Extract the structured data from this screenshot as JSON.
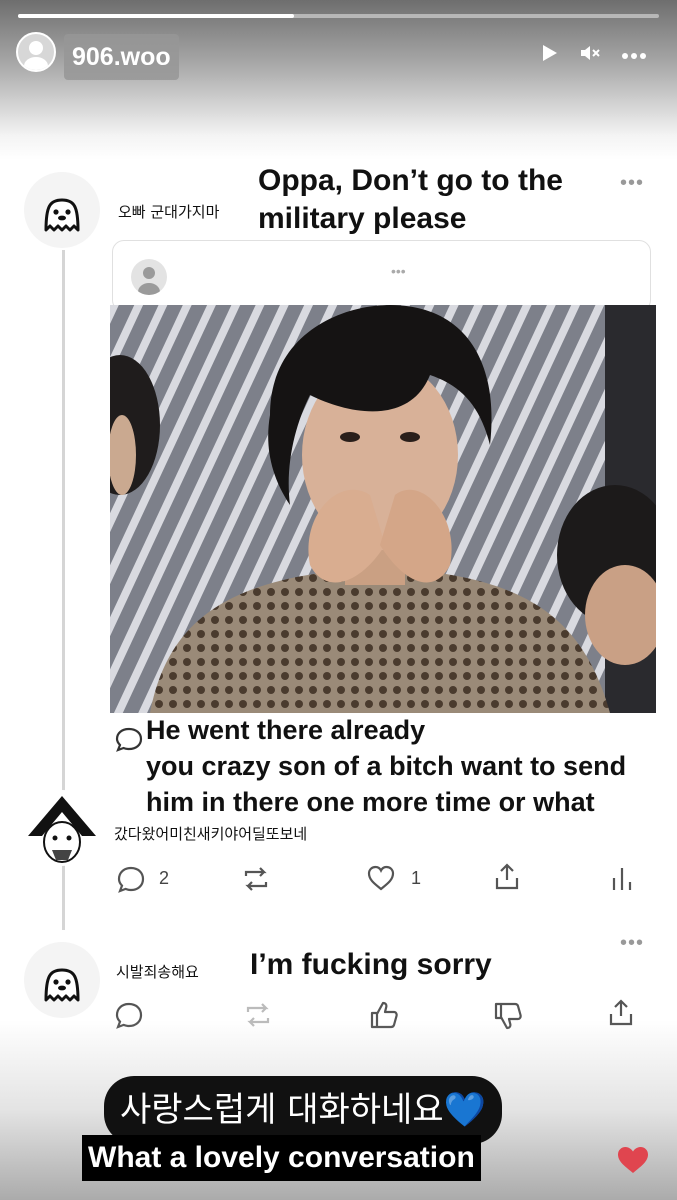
{
  "story": {
    "username": "906.woo",
    "progress": 0.43,
    "controls": [
      "play-icon",
      "mute-icon",
      "more-icon"
    ]
  },
  "post1": {
    "korean": "오빠 군대가지마",
    "english": "Oppa, Don’t go to the military please",
    "more": "•••"
  },
  "quoted": {
    "more": "•••"
  },
  "reply": {
    "english_line1": "He went there already",
    "english_line2": "you crazy son of a bitch want to send",
    "english_line3": "him in there one more time or what",
    "korean": "갔다왔어미친새키야어딜또보네",
    "comments": "2",
    "likes": "1"
  },
  "post3": {
    "korean": "시발죄송해요",
    "english": "I’m fucking sorry",
    "more": "•••"
  },
  "captions": {
    "korean": "사랑스럽게 대화하네요",
    "emoji": "💙",
    "english": "What a lovely conversation"
  },
  "colors": {
    "heart": "#e0454f",
    "accent_blue": "#3b7ad9"
  }
}
